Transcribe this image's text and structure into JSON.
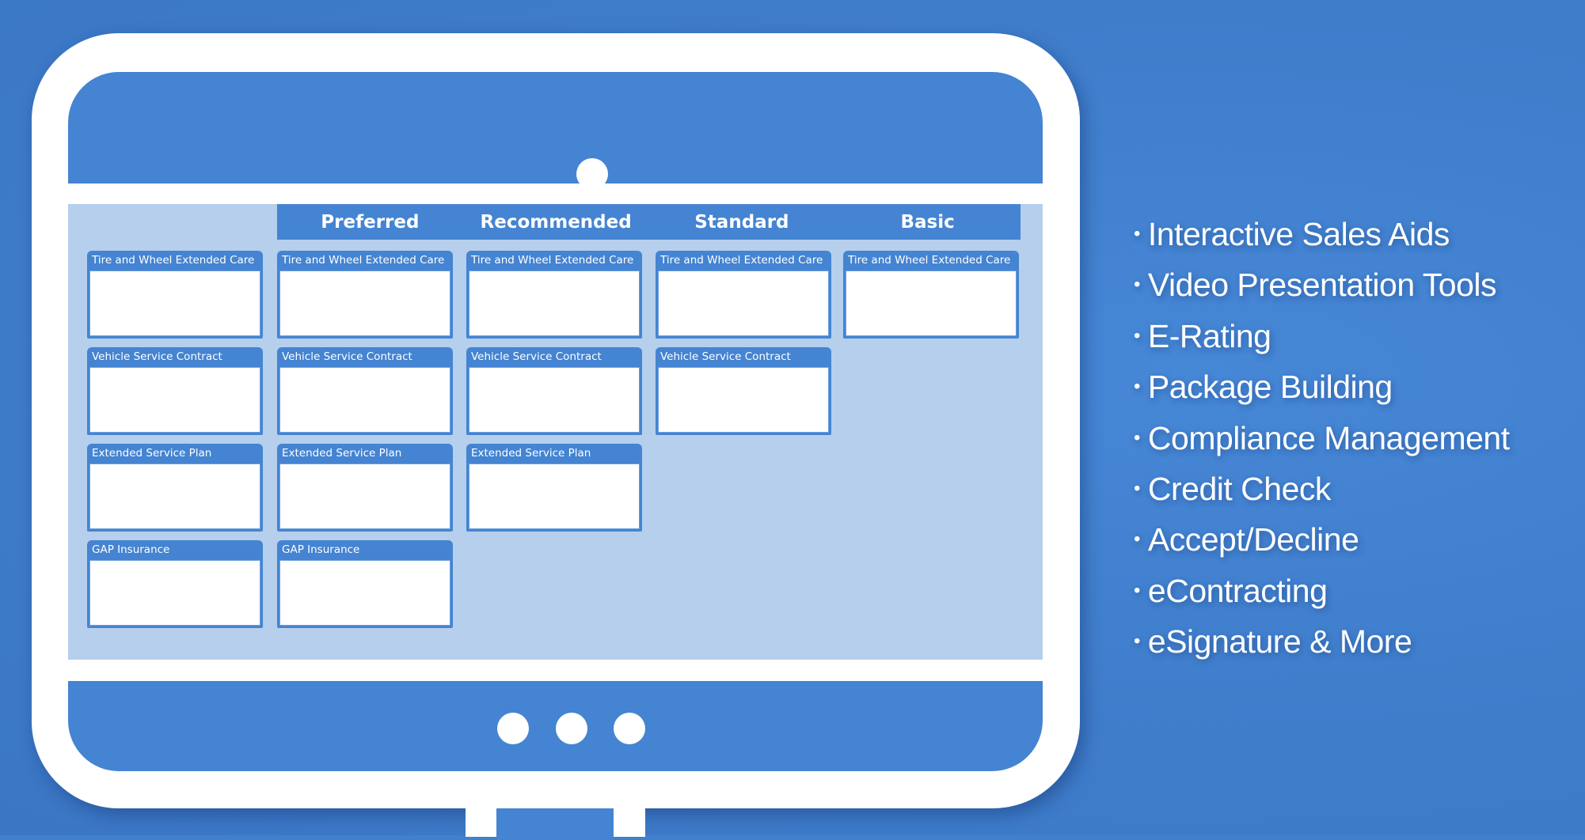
{
  "colors": {
    "background": "#4180cd",
    "bezel_blue": "#4484d2",
    "screen_light_blue": "#b5cfec",
    "frame_white": "#ffffff"
  },
  "monitor": {
    "camera_icon": "camera-dot",
    "home_dots_icon": "three-dots"
  },
  "menu": {
    "tiers": [
      {
        "label": "Preferred"
      },
      {
        "label": "Recommended"
      },
      {
        "label": "Standard"
      },
      {
        "label": "Basic"
      }
    ],
    "columns": [
      {
        "name": "products",
        "cards": [
          "Tire and Wheel Extended Care",
          "Vehicle Service Contract",
          "Extended Service Plan",
          "GAP Insurance"
        ]
      },
      {
        "name": "Preferred",
        "cards": [
          "Tire and Wheel Extended Care",
          "Vehicle Service Contract",
          "Extended Service Plan",
          "GAP Insurance"
        ]
      },
      {
        "name": "Recommended",
        "cards": [
          "Tire and Wheel Extended Care",
          "Vehicle Service Contract",
          "Extended Service Plan"
        ]
      },
      {
        "name": "Standard",
        "cards": [
          "Tire and Wheel Extended Care",
          "Vehicle Service Contract"
        ]
      },
      {
        "name": "Basic",
        "cards": [
          "Tire and Wheel Extended Care"
        ]
      }
    ]
  },
  "features": {
    "bullet": "•",
    "items": [
      "Interactive Sales Aids",
      "Video Presentation Tools",
      "E-Rating",
      "Package Building",
      "Compliance Management",
      "Credit Check",
      "Accept/Decline",
      "eContracting",
      "eSignature & More"
    ]
  }
}
